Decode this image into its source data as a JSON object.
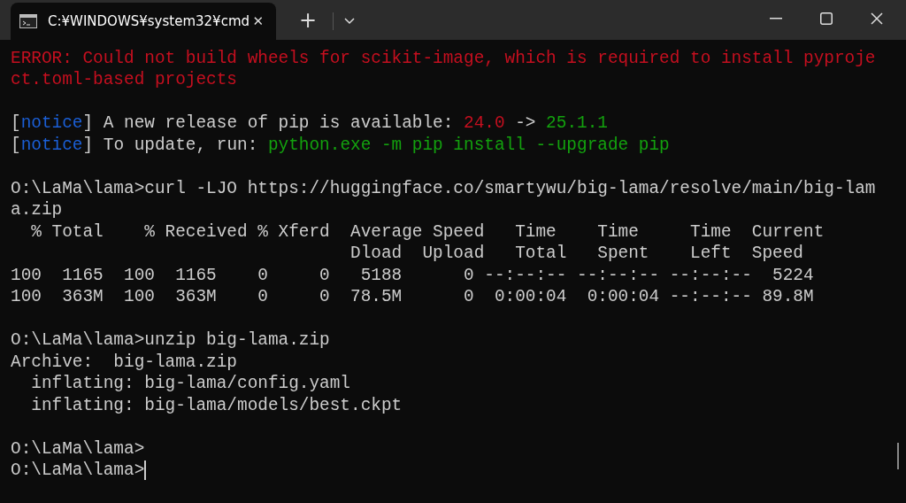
{
  "tab": {
    "title": "C:¥WINDOWS¥system32¥cmd",
    "selected": true,
    "close": "✕"
  },
  "new_tab": "+",
  "blocks": [
    [
      [
        {
          "kind": "error",
          "text": "ERROR: Could not build wheels for scikit-image, which is required to install pyproje"
        }
      ],
      [
        {
          "kind": "error",
          "text": "ct.toml-based projects"
        }
      ]
    ],
    [
      [
        {
          "kind": "plain",
          "text": "["
        },
        {
          "kind": "notice",
          "text": "notice"
        },
        {
          "kind": "plain",
          "text": "] A new release of pip is available: "
        },
        {
          "kind": "error",
          "text": "24.0"
        },
        {
          "kind": "plain",
          "text": " -> "
        },
        {
          "kind": "good",
          "text": "25.1.1"
        }
      ],
      [
        {
          "kind": "plain",
          "text": "["
        },
        {
          "kind": "notice",
          "text": "notice"
        },
        {
          "kind": "plain",
          "text": "] To update, run: "
        },
        {
          "kind": "good",
          "text": "python.exe -m pip install --upgrade pip"
        }
      ]
    ],
    [
      [
        {
          "kind": "plain",
          "text": "O:\\LaMa\\lama>curl -LJO https://huggingface.co/smartywu/big-lama/resolve/main/big-lam"
        }
      ],
      [
        {
          "kind": "plain",
          "text": "a.zip"
        }
      ],
      [
        {
          "kind": "plain",
          "text": "  % Total    % Received % Xferd  Average Speed   Time    Time     Time  Current"
        }
      ],
      [
        {
          "kind": "plain",
          "text": "                                 Dload  Upload   Total   Spent    Left  Speed"
        }
      ],
      [
        {
          "kind": "plain",
          "text": "100  1165  100  1165    0     0   5188      0 --:--:-- --:--:-- --:--:--  5224"
        }
      ],
      [
        {
          "kind": "plain",
          "text": "100  363M  100  363M    0     0  78.5M      0  0:00:04  0:00:04 --:--:-- 89.8M"
        }
      ]
    ],
    [
      [
        {
          "kind": "plain",
          "text": "O:\\LaMa\\lama>unzip big-lama.zip"
        }
      ],
      [
        {
          "kind": "plain",
          "text": "Archive:  big-lama.zip"
        }
      ],
      [
        {
          "kind": "plain",
          "text": "  inflating: big-lama/config.yaml"
        }
      ],
      [
        {
          "kind": "plain",
          "text": "  inflating: big-lama/models/best.ckpt"
        }
      ]
    ],
    [
      [
        {
          "kind": "plain",
          "text": "O:\\LaMa\\lama>"
        }
      ],
      [
        {
          "kind": "plain",
          "text": "O:\\LaMa\\lama>"
        }
      ]
    ]
  ],
  "cursor": true
}
